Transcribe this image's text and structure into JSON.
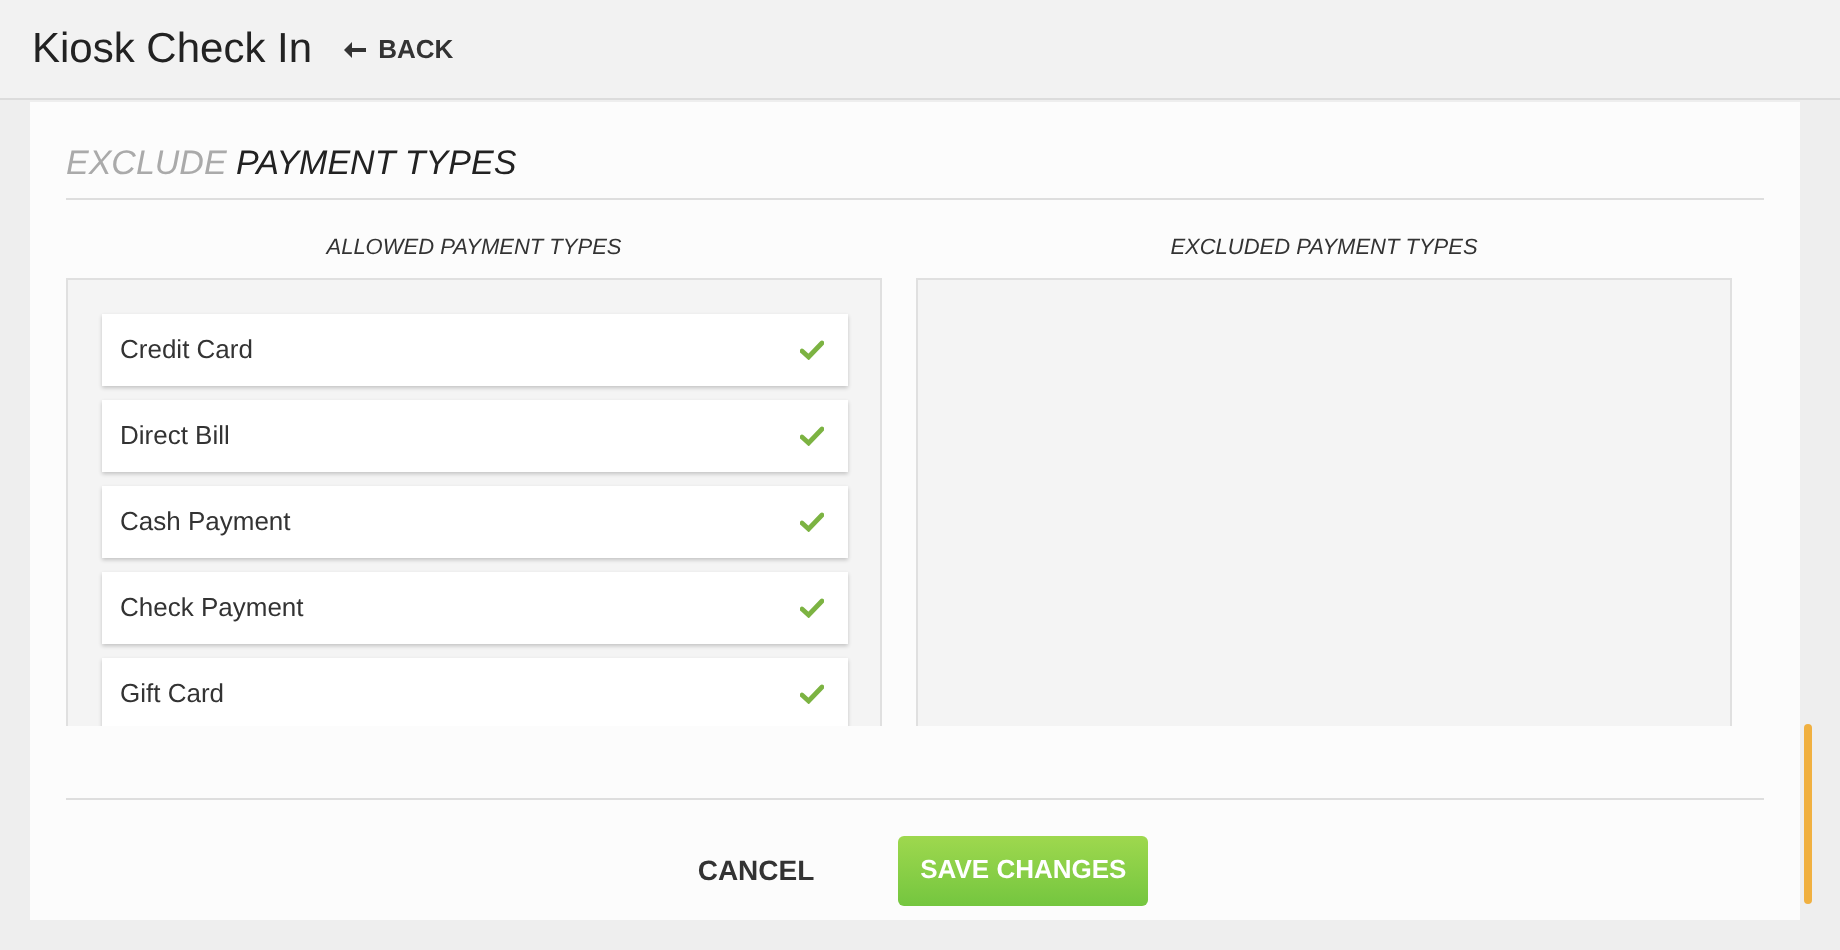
{
  "header": {
    "title": "Kiosk Check In",
    "back": "BACK"
  },
  "section": {
    "title_muted": "EXCLUDE",
    "title_main": "PAYMENT TYPES"
  },
  "allowed": {
    "heading": "ALLOWED PAYMENT TYPES",
    "items": [
      {
        "label": "Credit Card"
      },
      {
        "label": "Direct Bill"
      },
      {
        "label": "Cash Payment"
      },
      {
        "label": "Check Payment"
      },
      {
        "label": "Gift Card"
      }
    ]
  },
  "excluded": {
    "heading": "EXCLUDED PAYMENT TYPES"
  },
  "buttons": {
    "cancel": "CANCEL",
    "save": "SAVE CHANGES"
  }
}
